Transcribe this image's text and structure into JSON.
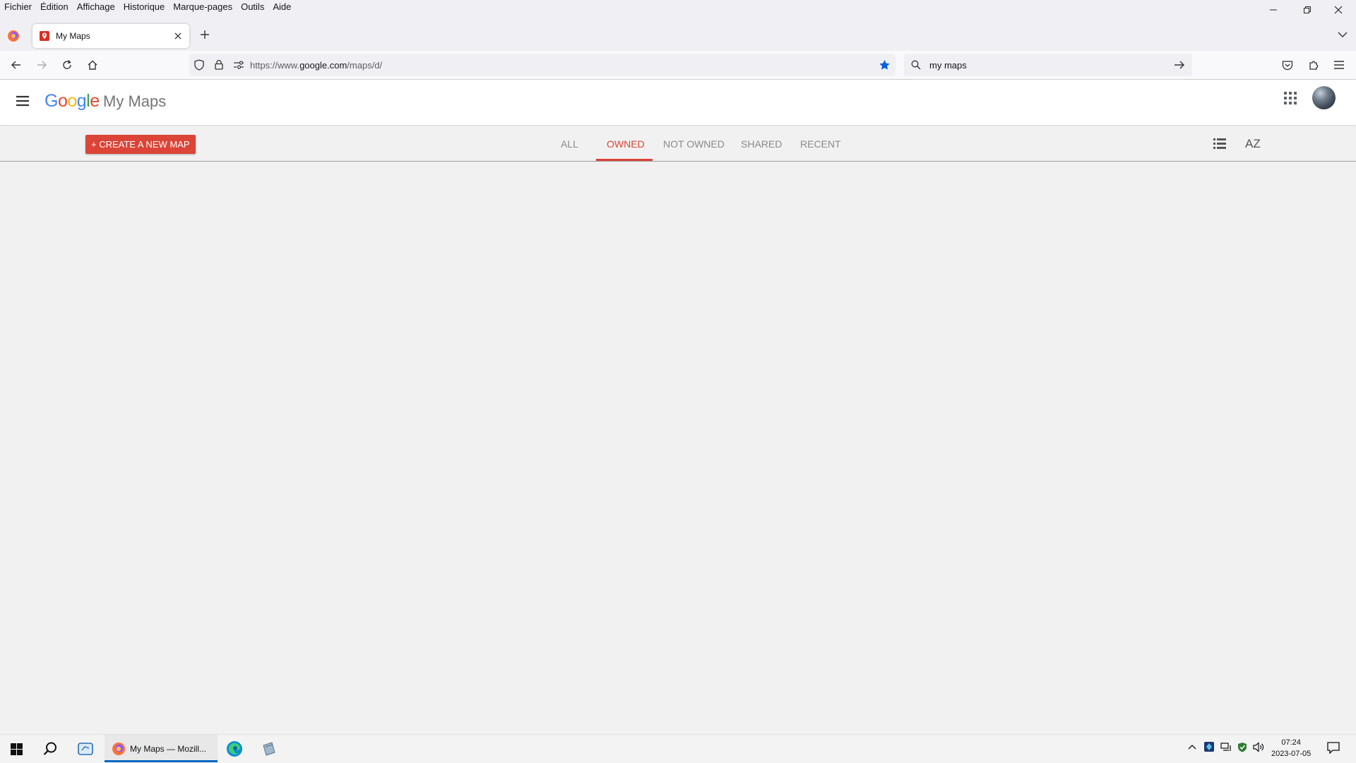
{
  "menubar": {
    "items": [
      "Fichier",
      "Édition",
      "Affichage",
      "Historique",
      "Marque-pages",
      "Outils",
      "Aide"
    ]
  },
  "browser": {
    "tab_title": "My Maps",
    "url_prefix": "https://www.",
    "url_host": "google.com",
    "url_path": "/maps/d/",
    "search_value": "my maps"
  },
  "page": {
    "logo_letters": [
      "G",
      "o",
      "o",
      "g",
      "l",
      "e"
    ],
    "logo_colors": [
      "#4285f4",
      "#ea4335",
      "#fbbc05",
      "#4285f4",
      "#34a853",
      "#ea4335"
    ],
    "app_title": "My Maps",
    "create_button": "+ CREATE A NEW MAP",
    "filter_tabs": [
      "ALL",
      "OWNED",
      "NOT OWNED",
      "SHARED",
      "RECENT"
    ],
    "active_filter": "OWNED",
    "sort_label": "AZ",
    "accent_color": "#db4437"
  },
  "taskbar": {
    "firefox_label": "My Maps — Mozill...",
    "time": "07:24",
    "date": "2023-07-05"
  }
}
